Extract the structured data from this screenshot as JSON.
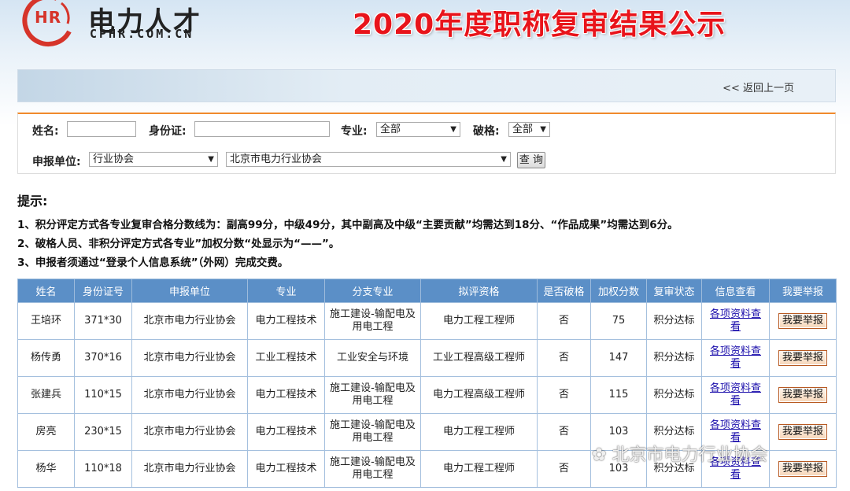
{
  "header": {
    "logo_name": "电力人才",
    "logo_domain": "CPHR.COM.CN",
    "logo_badge": "HR",
    "banner_title": "2020年度职称复审结果公示"
  },
  "nav": {
    "back_label": "<< 返回上一页"
  },
  "search": {
    "name_label": "姓名:",
    "name_value": "",
    "id_label": "身份证:",
    "id_value": "",
    "major_label": "专业:",
    "major_value": "全部",
    "exception_label": "破格:",
    "exception_value": "全部",
    "unit_label": "申报单位:",
    "unit_type_value": "行业协会",
    "unit_value": "北京市电力行业协会",
    "query_label": "查 询"
  },
  "tips": {
    "title": "提示:",
    "lines": [
      "1、积分评定方式各专业复审合格分数线为：副高99分，中级49分，其中副高及中级“主要贡献”均需达到18分、“作品成果”均需达到6分。",
      "2、破格人员、非积分评定方式各专业”加权分数“处显示为“——”。",
      "3、申报者须通过“登录个人信息系统”（外网）完成交费。"
    ]
  },
  "table": {
    "headers": [
      "姓名",
      "身份证号",
      "申报单位",
      "专业",
      "分支专业",
      "拟评资格",
      "是否破格",
      "加权分数",
      "复审状态",
      "信息查看",
      "我要举报"
    ],
    "view_label": "各项资料查看",
    "report_label": "我要举报",
    "rows": [
      [
        "王培环",
        "371*30",
        "北京市电力行业协会",
        "电力工程技术",
        "施工建设-输配电及用电工程",
        "电力工程工程师",
        "否",
        "75",
        "积分达标"
      ],
      [
        "杨传勇",
        "370*16",
        "北京市电力行业协会",
        "工业工程技术",
        "工业安全与环境",
        "工业工程高级工程师",
        "否",
        "147",
        "积分达标"
      ],
      [
        "张建兵",
        "110*15",
        "北京市电力行业协会",
        "电力工程技术",
        "施工建设-输配电及用电工程",
        "电力工程高级工程师",
        "否",
        "115",
        "积分达标"
      ],
      [
        "房亮",
        "230*15",
        "北京市电力行业协会",
        "电力工程技术",
        "施工建设-输配电及用电工程",
        "电力工程工程师",
        "否",
        "103",
        "积分达标"
      ],
      [
        "杨华",
        "110*18",
        "北京市电力行业协会",
        "电力工程技术",
        "施工建设-输配电及用电工程",
        "电力工程工程师",
        "否",
        "103",
        "积分达标"
      ]
    ]
  },
  "watermark": {
    "text": "北京市电力行业协会"
  },
  "colors": {
    "accent_orange": "#f08a2c",
    "title_red": "#e8141b",
    "table_header": "#5b8fc7",
    "link": "#1a0dab"
  }
}
